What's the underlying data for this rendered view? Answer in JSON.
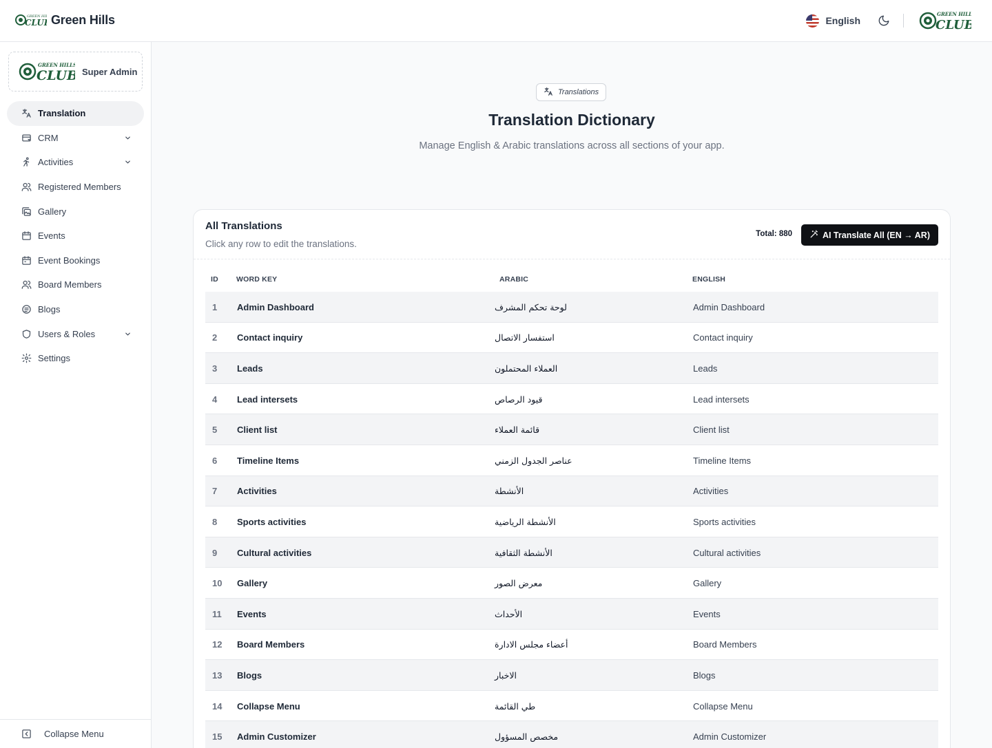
{
  "app": {
    "brand_name": "Green Hills",
    "logo_top": "GREEN HILLS",
    "logo_main": "CLUB"
  },
  "topbar": {
    "language": "English",
    "theme_icon": "moon-icon"
  },
  "sidebar": {
    "role": "Super Admin",
    "items": [
      {
        "label": "Translation",
        "icon": "translate-icon",
        "active": true,
        "expandable": false
      },
      {
        "label": "CRM",
        "icon": "crm-icon",
        "active": false,
        "expandable": true
      },
      {
        "label": "Activities",
        "icon": "activity-icon",
        "active": false,
        "expandable": true
      },
      {
        "label": "Registered Members",
        "icon": "users-icon",
        "active": false,
        "expandable": false
      },
      {
        "label": "Gallery",
        "icon": "gallery-icon",
        "active": false,
        "expandable": false
      },
      {
        "label": "Events",
        "icon": "calendar-icon",
        "active": false,
        "expandable": false
      },
      {
        "label": "Event Bookings",
        "icon": "calendar-icon",
        "active": false,
        "expandable": false
      },
      {
        "label": "Board Members",
        "icon": "users-icon",
        "active": false,
        "expandable": false
      },
      {
        "label": "Blogs",
        "icon": "blog-icon",
        "active": false,
        "expandable": false
      },
      {
        "label": "Users & Roles",
        "icon": "shield-icon",
        "active": false,
        "expandable": true
      },
      {
        "label": "Settings",
        "icon": "gear-icon",
        "active": false,
        "expandable": false
      }
    ],
    "collapse_label": "Collapse Menu"
  },
  "page": {
    "badge": "Translations",
    "title": "Translation Dictionary",
    "subtitle": "Manage English & Arabic translations across all sections of your app."
  },
  "card": {
    "title": "All Translations",
    "subtitle": "Click any row to edit the translations.",
    "total": "Total: 880",
    "ai_button": "AI Translate All (EN → AR)"
  },
  "table": {
    "headers": {
      "id": "ID",
      "key": "WORD KEY",
      "arabic": "ARABIC",
      "english": "ENGLISH"
    },
    "rows": [
      {
        "id": "1",
        "key": "Admin Dashboard",
        "ar": "لوحة تحكم المشرف",
        "en": "Admin Dashboard"
      },
      {
        "id": "2",
        "key": "Contact inquiry",
        "ar": "استفسار الاتصال",
        "en": "Contact inquiry"
      },
      {
        "id": "3",
        "key": "Leads",
        "ar": "العملاء المحتملون",
        "en": "Leads"
      },
      {
        "id": "4",
        "key": "Lead intersets",
        "ar": "قيود الرصاص",
        "en": "Lead intersets"
      },
      {
        "id": "5",
        "key": "Client list",
        "ar": "قائمة العملاء",
        "en": "Client list"
      },
      {
        "id": "6",
        "key": "Timeline Items",
        "ar": "عناصر الجدول الزمني",
        "en": "Timeline Items"
      },
      {
        "id": "7",
        "key": "Activities",
        "ar": "الأنشطة",
        "en": "Activities"
      },
      {
        "id": "8",
        "key": "Sports activities",
        "ar": "الأنشطة الرياضية",
        "en": "Sports activities"
      },
      {
        "id": "9",
        "key": "Cultural activities",
        "ar": "الأنشطة الثقافية",
        "en": "Cultural activities"
      },
      {
        "id": "10",
        "key": "Gallery",
        "ar": "معرض الصور",
        "en": "Gallery"
      },
      {
        "id": "11",
        "key": "Events",
        "ar": "الأحداث",
        "en": "Events"
      },
      {
        "id": "12",
        "key": "Board Members",
        "ar": "أعضاء مجلس الادارة",
        "en": "Board Members"
      },
      {
        "id": "13",
        "key": "Blogs",
        "ar": "الاخبار",
        "en": "Blogs"
      },
      {
        "id": "14",
        "key": "Collapse Menu",
        "ar": "طي القائمة",
        "en": "Collapse Menu"
      },
      {
        "id": "15",
        "key": "Admin Customizer",
        "ar": "مخصص المسؤول",
        "en": "Admin Customizer"
      }
    ]
  },
  "colors": {
    "brand_green": "#1f5e3a",
    "active_bg": "#f1f2f4",
    "button_dark": "#0f1115",
    "row_alt": "#f3f4f6"
  }
}
